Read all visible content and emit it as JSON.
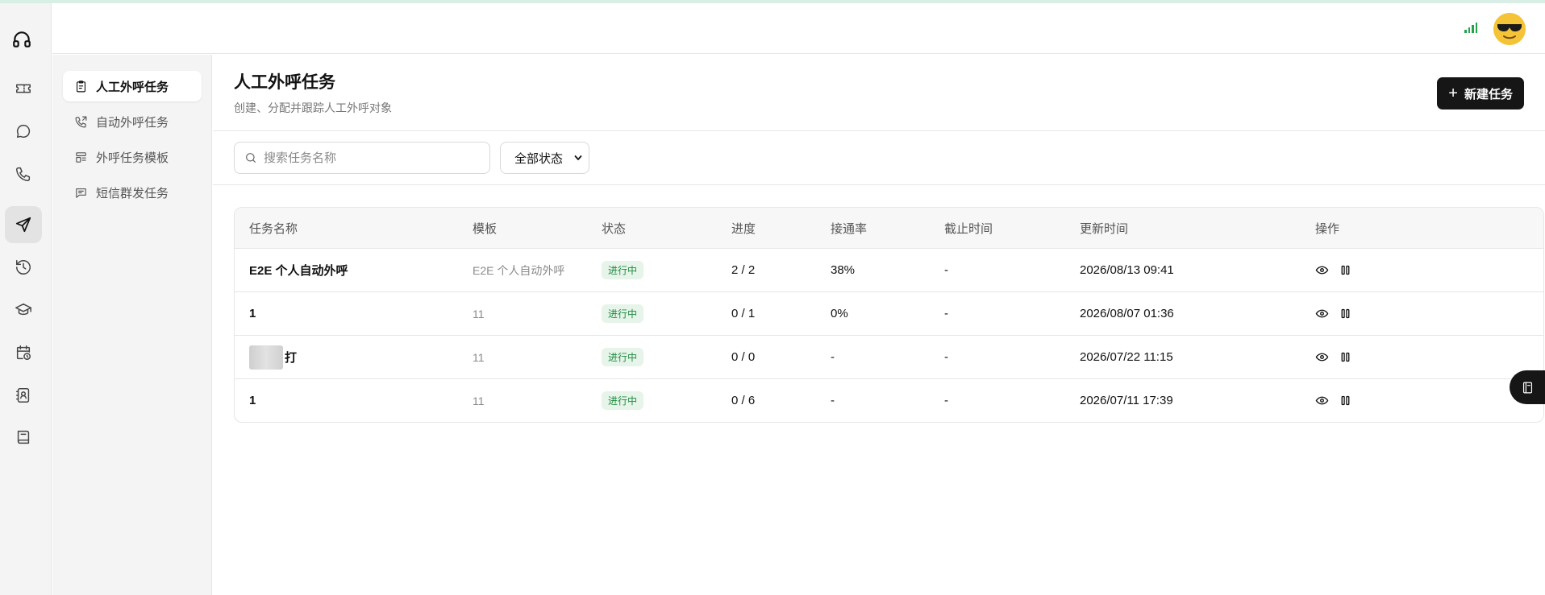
{
  "colors": {
    "accent": "#161616",
    "status_green": "#1f8a3e",
    "status_bg": "#e6f4ea",
    "signal": "#22a34a",
    "avatar": "#f5c338"
  },
  "rail": {
    "items": [
      {
        "icon": "headset-icon"
      },
      {
        "icon": "ticket-icon"
      },
      {
        "icon": "chat-icon"
      },
      {
        "icon": "phone-icon"
      },
      {
        "icon": "send-icon",
        "active": true
      },
      {
        "icon": "history-icon"
      },
      {
        "icon": "graduation-cap-icon"
      },
      {
        "icon": "calendar-clock-icon"
      },
      {
        "icon": "contacts-book-icon"
      },
      {
        "icon": "book-icon"
      }
    ]
  },
  "subnav": {
    "items": [
      {
        "label": "人工外呼任务",
        "icon": "clipboard-icon",
        "active": true
      },
      {
        "label": "自动外呼任务",
        "icon": "phone-outgoing-icon"
      },
      {
        "label": "外呼任务模板",
        "icon": "template-icon"
      },
      {
        "label": "短信群发任务",
        "icon": "message-square-icon"
      }
    ]
  },
  "header": {
    "title": "人工外呼任务",
    "subtitle": "创建、分配并跟踪人工外呼对象",
    "new_button": "新建任务"
  },
  "filters": {
    "search_placeholder": "搜索任务名称",
    "status_select": "全部状态"
  },
  "table": {
    "columns": [
      "任务名称",
      "模板",
      "状态",
      "进度",
      "接通率",
      "截止时间",
      "更新时间",
      "操作"
    ],
    "rows": [
      {
        "name": "E2E 个人自动外呼",
        "template": "E2E 个人自动外呼",
        "status": "进行中",
        "progress": "2 / 2",
        "rate": "38%",
        "deadline": "-",
        "updated": "2026/08/13 09:41"
      },
      {
        "name": "1",
        "template": "11",
        "status": "进行中",
        "progress": "0 / 1",
        "rate": "0%",
        "deadline": "-",
        "updated": "2026/08/07 01:36"
      },
      {
        "name": "打",
        "template": "11",
        "status": "进行中",
        "progress": "0 / 0",
        "rate": "-",
        "deadline": "-",
        "updated": "2026/07/22 11:15"
      },
      {
        "name": "1",
        "template": "11",
        "status": "进行中",
        "progress": "0 / 6",
        "rate": "-",
        "deadline": "-",
        "updated": "2026/07/11 17:39"
      }
    ]
  }
}
